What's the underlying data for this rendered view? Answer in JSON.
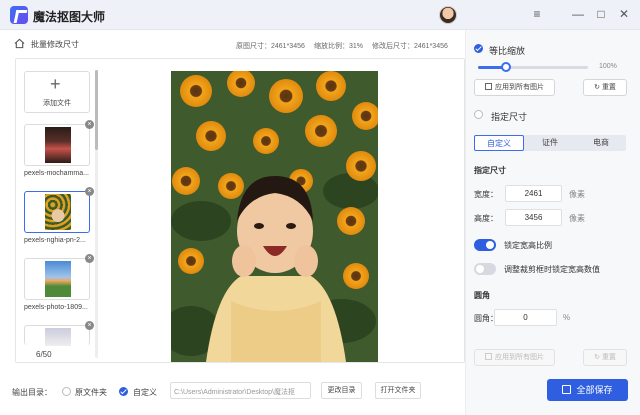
{
  "app": {
    "title": "魔法抠图大师"
  },
  "window": {
    "menu_icon": "≡",
    "minimize_icon": "—",
    "maximize_icon": "□",
    "close_icon": "✕"
  },
  "header": {
    "batch_label": "批量修改尺寸",
    "original_size": "原图尺寸：2461*3456",
    "scale_ratio": "缩放比例：31%",
    "modified_size": "修改后尺寸：2461*3456"
  },
  "sidebar": {
    "add_label": "添加文件",
    "files": [
      {
        "name": "pexels-mochamma...",
        "selected": false
      },
      {
        "name": "pexels-nghia-pn-2...",
        "selected": true
      },
      {
        "name": "pexels-photo-1809...",
        "selected": false
      },
      {
        "name": "",
        "selected": false
      }
    ],
    "count": "6/50"
  },
  "output": {
    "label": "输出目录：",
    "option_original": "原文件夹",
    "option_custom": "自定义",
    "path": "C:\\Users\\Administrator\\Desktop\\魔法抠",
    "change_btn": "更改目录",
    "open_btn": "打开文件夹"
  },
  "panel": {
    "proportional": "等比缩放",
    "percent": "100%",
    "slider_value": 0.25,
    "apply_all": "应用到所有图片",
    "reset": "重置",
    "specify_size": "指定尺寸",
    "tabs": [
      "自定义",
      "证件",
      "电商"
    ],
    "size_section": "指定尺寸",
    "width_label": "宽度：",
    "width_value": "2461",
    "height_label": "高度：",
    "height_value": "3456",
    "unit_px": "像素",
    "lock_ratio": "锁定宽高比例",
    "lock_crop": "调整裁剪框时锁定宽高数值",
    "corner_section": "圆角",
    "corner_label": "圆角：",
    "corner_value": "0",
    "corner_unit": "%",
    "apply_all_2": "应用到所有图片",
    "reset_2": "重置",
    "save_all": "全部保存"
  },
  "colors": {
    "accent": "#2f5fe0"
  }
}
